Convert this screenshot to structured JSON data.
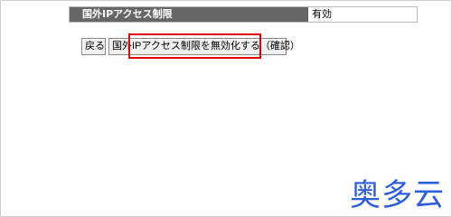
{
  "setting": {
    "label": "国外IPアクセス制限",
    "value": "有効"
  },
  "buttons": {
    "back": "戻る",
    "disable": "国外IPアクセス制限を無効化する（確認）"
  },
  "watermark": {
    "text": "奥多云"
  },
  "colors": {
    "highlight": "#e00000",
    "header_bg": "#666666",
    "watermark": "#2f5fd8"
  }
}
